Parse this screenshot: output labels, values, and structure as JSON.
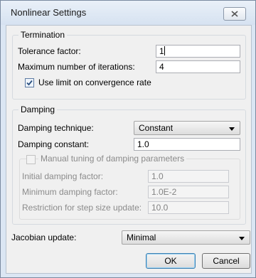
{
  "window": {
    "title": "Nonlinear Settings"
  },
  "termination": {
    "group_label": "Termination",
    "tolerance_label": "Tolerance factor:",
    "tolerance_value": "1",
    "max_iter_label": "Maximum number of iterations:",
    "max_iter_value": "4",
    "use_limit_label": "Use limit on convergence rate",
    "use_limit_checked": true
  },
  "damping": {
    "group_label": "Damping",
    "technique_label": "Damping technique:",
    "technique_value": "Constant",
    "constant_label": "Damping constant:",
    "constant_value": "1.0",
    "manual": {
      "label": "Manual tuning of damping parameters",
      "checked": false,
      "initial_label": "Initial damping factor:",
      "initial_value": "1.0",
      "minimum_label": "Minimum damping factor:",
      "minimum_value": "1.0E-2",
      "restriction_label": "Restriction for step size update:",
      "restriction_value": "10.0"
    }
  },
  "jacobian": {
    "label": "Jacobian update:",
    "value": "Minimal"
  },
  "buttons": {
    "ok": "OK",
    "cancel": "Cancel"
  },
  "icons": {
    "close": "close-icon",
    "checkmark": "checkmark-icon",
    "dropdown": "chevron-down-icon"
  }
}
